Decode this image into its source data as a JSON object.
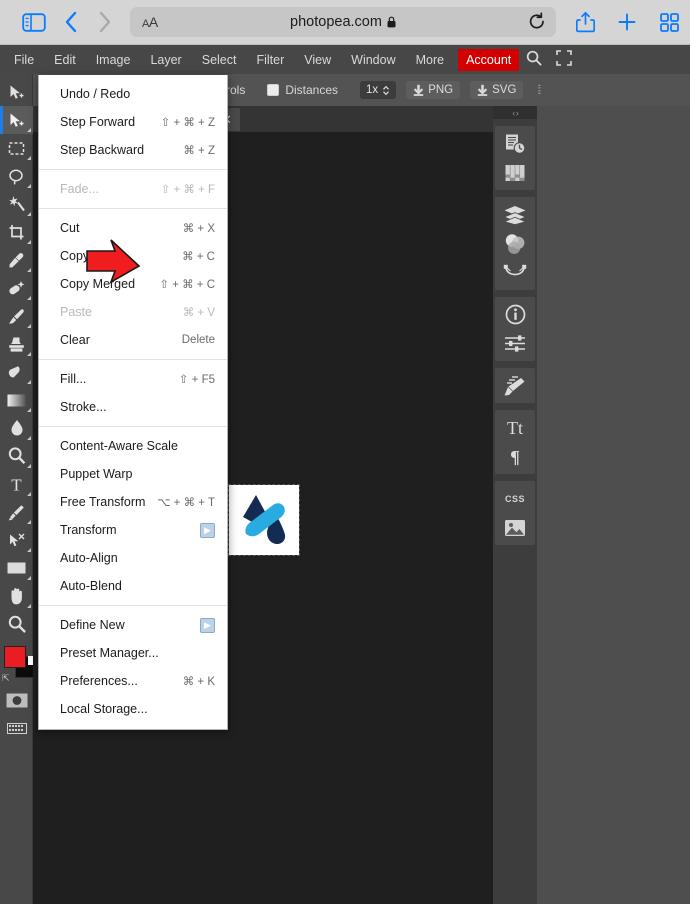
{
  "browser": {
    "url": "photopea.com",
    "lock_icon": "lock-icon",
    "aa_label": "AA",
    "sidebar_icon": "sidebar-toggle-icon",
    "back_icon": "back-chevron-icon",
    "forward_icon": "forward-chevron-icon",
    "reload_icon": "reload-icon",
    "share_icon": "share-icon",
    "newtab_icon": "plus-icon",
    "tabs_icon": "tab-overview-icon",
    "accent": "#0a7cff"
  },
  "menubar": {
    "items": [
      {
        "label": "File"
      },
      {
        "label": "Edit"
      },
      {
        "label": "Image"
      },
      {
        "label": "Layer"
      },
      {
        "label": "Select"
      },
      {
        "label": "Filter"
      },
      {
        "label": "View"
      },
      {
        "label": "Window"
      },
      {
        "label": "More"
      }
    ],
    "account_label": "Account",
    "account_color": "#d20000",
    "search_icon": "search-icon",
    "fullscreen_icon": "fullscreen-icon"
  },
  "optionsbar": {
    "controls_label": "ntrols",
    "distances_label": "Distances",
    "distances_checked": false,
    "zoom_value": "1x",
    "zoom_caret": "chevron-updown-icon",
    "png_label": "PNG",
    "svg_label": "SVG",
    "download_icon": "download-icon",
    "grip_icon": "drag-grip-icon"
  },
  "toolbar": {
    "tools": [
      {
        "name": "move-tool",
        "glyph": "move",
        "selected": false,
        "has_submenu": false
      },
      {
        "name": "artboard-tool",
        "glyph": "move",
        "selected": true,
        "has_submenu": true
      },
      {
        "name": "rectangle-select-tool",
        "glyph": "marquee",
        "selected": false,
        "has_submenu": true
      },
      {
        "name": "lasso-tool",
        "glyph": "lasso",
        "selected": false,
        "has_submenu": true
      },
      {
        "name": "magic-wand-tool",
        "glyph": "wand",
        "selected": false,
        "has_submenu": true
      },
      {
        "name": "crop-tool",
        "glyph": "crop",
        "selected": false,
        "has_submenu": true
      },
      {
        "name": "eyedropper-tool",
        "glyph": "dropper",
        "selected": false,
        "has_submenu": true
      },
      {
        "name": "spot-healing-tool",
        "glyph": "heal",
        "selected": false,
        "has_submenu": true
      },
      {
        "name": "brush-tool",
        "glyph": "brush",
        "selected": false,
        "has_submenu": true
      },
      {
        "name": "stamp-tool",
        "glyph": "stamp",
        "selected": false,
        "has_submenu": true
      },
      {
        "name": "eraser-tool",
        "glyph": "eraser",
        "selected": false,
        "has_submenu": true
      },
      {
        "name": "gradient-tool",
        "glyph": "gradient",
        "selected": false,
        "has_submenu": true
      },
      {
        "name": "blur-tool",
        "glyph": "blur",
        "selected": false,
        "has_submenu": true
      },
      {
        "name": "dodge-tool",
        "glyph": "dodge",
        "selected": false,
        "has_submenu": true
      },
      {
        "name": "type-tool",
        "glyph": "type",
        "selected": false,
        "has_submenu": true
      },
      {
        "name": "pen-tool",
        "glyph": "pen",
        "selected": false,
        "has_submenu": true
      },
      {
        "name": "path-select-tool",
        "glyph": "pathselect",
        "selected": false,
        "has_submenu": true
      },
      {
        "name": "shape-tool",
        "glyph": "shape",
        "selected": false,
        "has_submenu": true
      },
      {
        "name": "hand-tool",
        "glyph": "hand",
        "selected": false,
        "has_submenu": true
      },
      {
        "name": "zoom-tool",
        "glyph": "zoom",
        "selected": false,
        "has_submenu": false
      }
    ],
    "foreground_color": "#ec1c24",
    "background_color": "#0b0b0b",
    "reset_colors_icon": "reset-colors-icon",
    "quickmask_icon": "quick-mask-icon",
    "screenmode_icon": "screen-mode-icon"
  },
  "canvas": {
    "tab_close_icon": "close-icon",
    "artwork_name": "logo-artwork"
  },
  "rightrail": {
    "handle_icon": "collapse-handle-icon",
    "groups": [
      {
        "icons": [
          {
            "name": "history-panel-icon"
          },
          {
            "name": "swatches-panel-icon"
          }
        ]
      },
      {
        "icons": [
          {
            "name": "layers-panel-icon"
          },
          {
            "name": "channels-panel-icon"
          },
          {
            "name": "paths-panel-icon"
          }
        ]
      },
      {
        "icons": [
          {
            "name": "info-panel-icon"
          },
          {
            "name": "adjustments-panel-icon"
          }
        ]
      },
      {
        "icons": [
          {
            "name": "brushes-panel-icon"
          }
        ]
      },
      {
        "icons": [
          {
            "name": "character-panel-icon"
          },
          {
            "name": "paragraph-panel-icon"
          }
        ]
      },
      {
        "icons": [
          {
            "name": "css-panel-icon",
            "text": "CSS"
          },
          {
            "name": "image-panel-icon"
          }
        ]
      }
    ]
  },
  "edit_menu": {
    "groups": [
      {
        "items": [
          {
            "label": "Undo / Redo",
            "accel": "",
            "disabled": false,
            "submenu": false
          },
          {
            "label": "Step Forward",
            "accel": "⇧ + ⌘ + Z",
            "disabled": false,
            "submenu": false
          },
          {
            "label": "Step Backward",
            "accel": "⌘ + Z",
            "disabled": false,
            "submenu": false
          }
        ]
      },
      {
        "items": [
          {
            "label": "Fade...",
            "accel": "⇧ + ⌘ + F",
            "disabled": true,
            "submenu": false
          }
        ]
      },
      {
        "items": [
          {
            "label": "Cut",
            "accel": "⌘ + X",
            "disabled": false,
            "submenu": false
          },
          {
            "label": "Copy",
            "accel": "⌘ + C",
            "disabled": false,
            "submenu": false
          },
          {
            "label": "Copy Merged",
            "accel": "⇧ + ⌘ + C",
            "disabled": false,
            "submenu": false
          },
          {
            "label": "Paste",
            "accel": "⌘ + V",
            "disabled": true,
            "submenu": false
          },
          {
            "label": "Clear",
            "accel": "Delete",
            "disabled": false,
            "submenu": false
          }
        ]
      },
      {
        "items": [
          {
            "label": "Fill...",
            "accel": "⇧ + F5",
            "disabled": false,
            "submenu": false
          },
          {
            "label": "Stroke...",
            "accel": "",
            "disabled": false,
            "submenu": false
          }
        ]
      },
      {
        "items": [
          {
            "label": "Content-Aware Scale",
            "accel": "",
            "disabled": false,
            "submenu": false
          },
          {
            "label": "Puppet Warp",
            "accel": "",
            "disabled": false,
            "submenu": false
          },
          {
            "label": "Free Transform",
            "accel": "⌥ + ⌘ + T",
            "disabled": false,
            "submenu": false
          },
          {
            "label": "Transform",
            "accel": "",
            "disabled": false,
            "submenu": true
          },
          {
            "label": "Auto-Align",
            "accel": "",
            "disabled": false,
            "submenu": false
          },
          {
            "label": "Auto-Blend",
            "accel": "",
            "disabled": false,
            "submenu": false
          }
        ]
      },
      {
        "items": [
          {
            "label": "Define New",
            "accel": "",
            "disabled": false,
            "submenu": true
          },
          {
            "label": "Preset Manager...",
            "accel": "",
            "disabled": false,
            "submenu": false
          },
          {
            "label": "Preferences...",
            "accel": "⌘ + K",
            "disabled": false,
            "submenu": false
          },
          {
            "label": "Local Storage...",
            "accel": "",
            "disabled": false,
            "submenu": false
          }
        ]
      }
    ]
  },
  "cursor": {
    "name": "red-arrow-pointer",
    "color": "#ef1d1d"
  }
}
